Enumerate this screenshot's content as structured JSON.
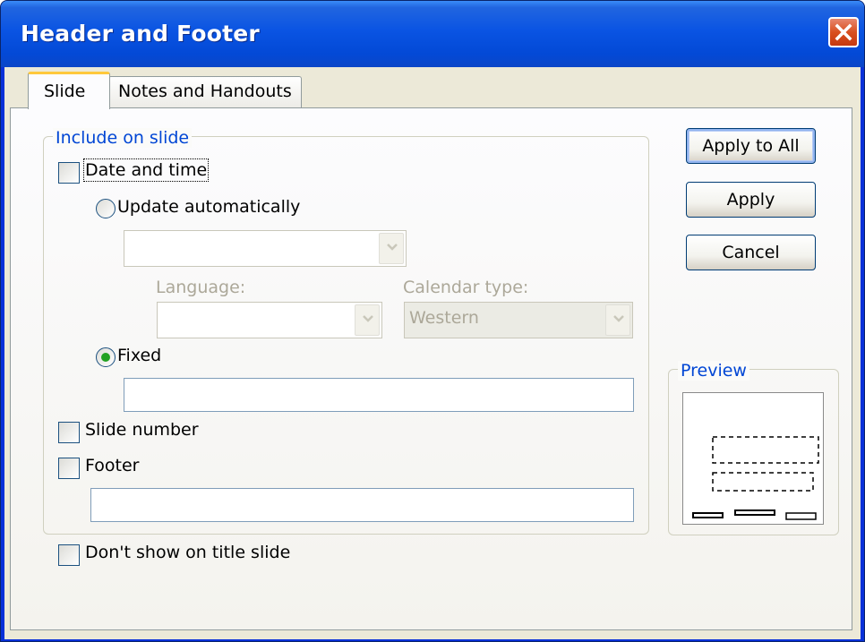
{
  "window": {
    "title": "Header and Footer",
    "close_icon": "close-icon"
  },
  "tabs": [
    {
      "label": "Slide",
      "active": true
    },
    {
      "label": "Notes and Handouts",
      "active": false
    }
  ],
  "include_group": {
    "legend": "Include on slide",
    "date_time": {
      "label": "Date and time",
      "checked": false
    },
    "update_automatically": {
      "label": "Update automatically",
      "selected": false
    },
    "date_format": {
      "value": ""
    },
    "language": {
      "label": "Language:",
      "value": ""
    },
    "calendar_type": {
      "label": "Calendar type:",
      "value": "Western"
    },
    "fixed": {
      "label": "Fixed",
      "selected": true
    },
    "fixed_input": {
      "value": ""
    },
    "slide_number": {
      "label": "Slide number",
      "checked": false
    },
    "footer": {
      "label": "Footer",
      "checked": false
    },
    "footer_input": {
      "value": ""
    }
  },
  "dont_show_title": {
    "label": "Don't show on title slide",
    "checked": false
  },
  "buttons": {
    "apply_all": "Apply to All",
    "apply": "Apply",
    "cancel": "Cancel"
  },
  "preview": {
    "legend": "Preview"
  },
  "colors": {
    "titlebar": "#0a54e3",
    "legend_text": "#0046d5",
    "dialog_bg": "#ece9d8",
    "radio_dot": "#21a121",
    "close_button": "#d9501f"
  }
}
